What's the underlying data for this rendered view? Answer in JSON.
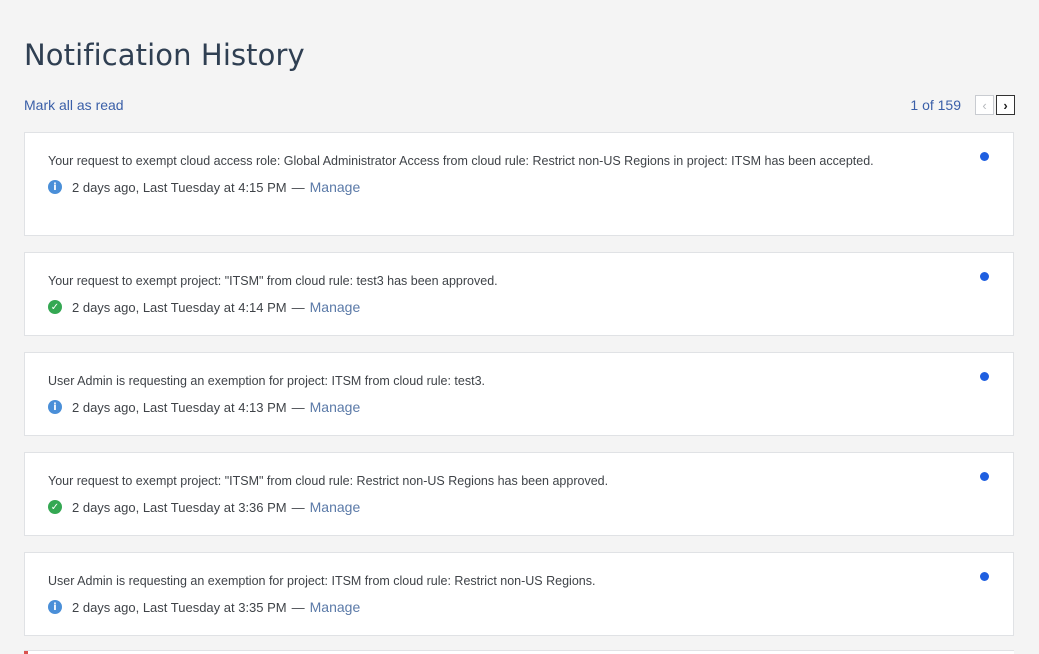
{
  "page": {
    "title": "Notification History"
  },
  "toolbar": {
    "mark_all_label": "Mark all as read",
    "pager_text": "1 of 159",
    "prev_label": "‹",
    "next_label": "›"
  },
  "notifications": [
    {
      "message": "Your request to exempt cloud access role: Global Administrator Access from cloud rule: Restrict non-US Regions in project: ITSM has been accepted.",
      "status": "info-icon",
      "time": "2 days ago, Last Tuesday at 4:15 PM",
      "separator": "—",
      "action": "Manage",
      "unread": true
    },
    {
      "message": "Your request to exempt project: \"ITSM\" from cloud rule: test3 has been approved.",
      "status": "check-icon",
      "time": "2 days ago, Last Tuesday at 4:14 PM",
      "separator": "—",
      "action": "Manage",
      "unread": true
    },
    {
      "message": "User Admin is requesting an exemption for project: ITSM from cloud rule: test3.",
      "status": "info-icon",
      "time": "2 days ago, Last Tuesday at 4:13 PM",
      "separator": "—",
      "action": "Manage",
      "unread": true
    },
    {
      "message": "Your request to exempt project: \"ITSM\" from cloud rule: Restrict non-US Regions has been approved.",
      "status": "check-icon",
      "time": "2 days ago, Last Tuesday at 3:36 PM",
      "separator": "—",
      "action": "Manage",
      "unread": true
    },
    {
      "message": "User Admin is requesting an exemption for project: ITSM from cloud rule: Restrict non-US Regions.",
      "status": "info-icon",
      "time": "2 days ago, Last Tuesday at 3:35 PM",
      "separator": "—",
      "action": "Manage",
      "unread": true
    }
  ],
  "colors": {
    "link": "#3a5fa8",
    "unread_dot": "#1f5fe0",
    "info": "#4a8fd8",
    "success": "#35a853"
  }
}
